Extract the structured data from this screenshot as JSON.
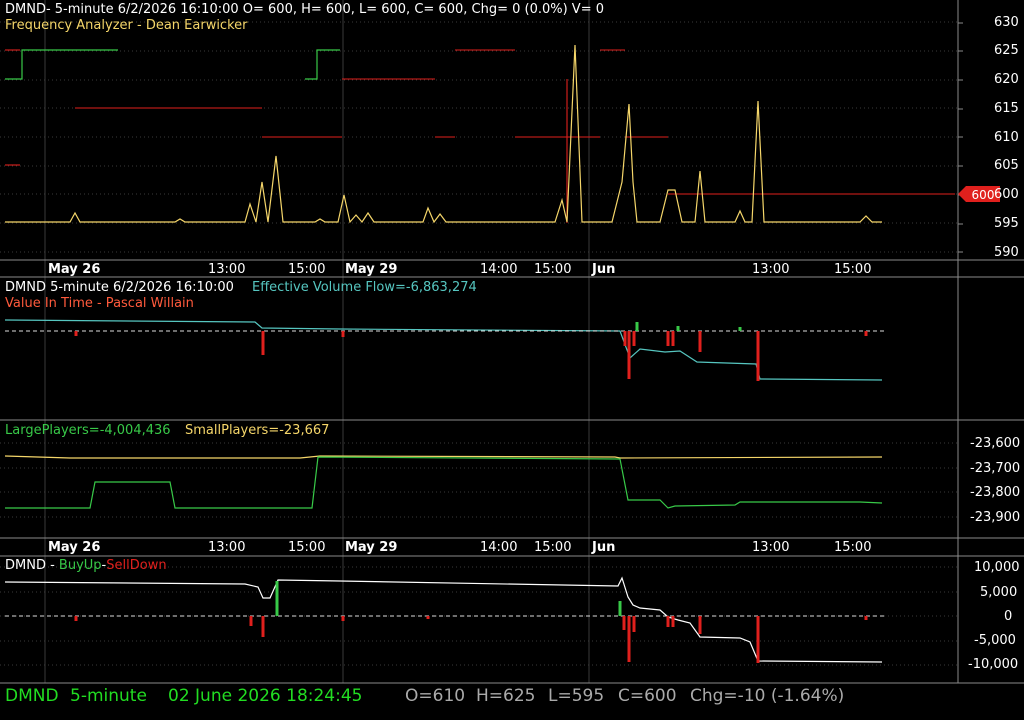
{
  "colors": {
    "bg": "#000000",
    "grid": "#3a3a3a",
    "divider": "#8a8a8a",
    "red": "#e0201d",
    "yellow": "#f5d66a",
    "green": "#38c948",
    "cyan": "#56c6c0",
    "orange": "#ff5a3c",
    "white": "#ffffff",
    "statusgreen": "#22dd22",
    "statusgray": "#aaaaaa"
  },
  "panel1": {
    "header": "DMND- 5-minute 6/2/2026 16:10:00 O= 600, H= 600, L= 600, C= 600, Chg= 0 (0.0%) V= 0",
    "study": "Frequency Analyzer - Dean Earwicker",
    "yaxis": [
      "630",
      "625",
      "620",
      "615",
      "610",
      "605",
      "600",
      "595",
      "590"
    ],
    "price_tag": "600"
  },
  "time_axis": [
    "May 26",
    "13:00",
    "15:00",
    "May 29",
    "14:00",
    "15:00",
    "Jun",
    "13:00",
    "15:00"
  ],
  "panel2": {
    "header_left": "DMND 5-minute  6/2/2026 16:10:00",
    "header_right": "Effective Volume Flow=-6,863,274",
    "study": "Value In Time - Pascal Willain"
  },
  "panel3": {
    "large": "LargePlayers=-4,004,436",
    "small": "SmallPlayers=-23,667",
    "yaxis": [
      "-23,600",
      "-23,700",
      "-23,800",
      "-23,900"
    ]
  },
  "panel4": {
    "prefix": "DMND - ",
    "buy": "BuyUp",
    "sep": "-",
    "sell": "SellDown",
    "yaxis": [
      "10,000",
      "5,000",
      "0",
      "-5,000",
      "-10,000"
    ]
  },
  "status": {
    "symbol": "DMND",
    "interval": "5-minute",
    "datetime": "02 June 2026 18:24:45",
    "open": "O=610",
    "high": "H=625",
    "low": "L=595",
    "close": "C=600",
    "change": "Chg=-10 (-1.64%)"
  }
}
